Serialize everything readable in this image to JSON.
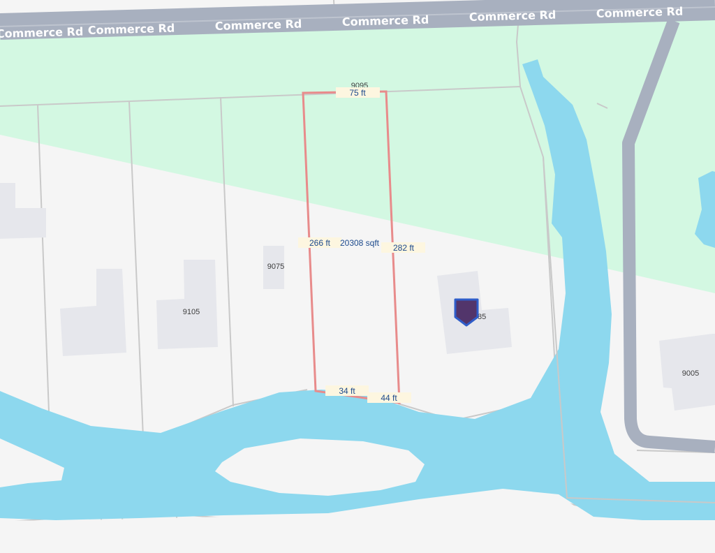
{
  "map": {
    "road_name": "Commerce Rd",
    "road_labels": [
      "Commerce Rd",
      "Commerce Rd",
      "Commerce Rd",
      "Commerce Rd",
      "Commerce Rd",
      "Commerce Rd"
    ],
    "parcel_numbers": {
      "top": "9095",
      "left_a": "9075",
      "left_b": "9105",
      "right": "9005",
      "marker_house": "9085"
    },
    "selected_parcel": {
      "front": "75 ft",
      "left_side": "266 ft",
      "area": "20308 sqft",
      "right_side": "282 ft",
      "rear_a": "34 ft",
      "rear_b": "44 ft"
    },
    "marker": {
      "icon": "home-marker-icon"
    },
    "colors": {
      "water": "#8dd8ee",
      "park": "#d3f8e2",
      "road": "#a8b0bf",
      "parcel_line": "#c9c9c9",
      "building": "#e6e7ec",
      "selected_outline": "#e88b8b",
      "marker": "#52356b",
      "marker_border": "#2f5dc9"
    }
  }
}
